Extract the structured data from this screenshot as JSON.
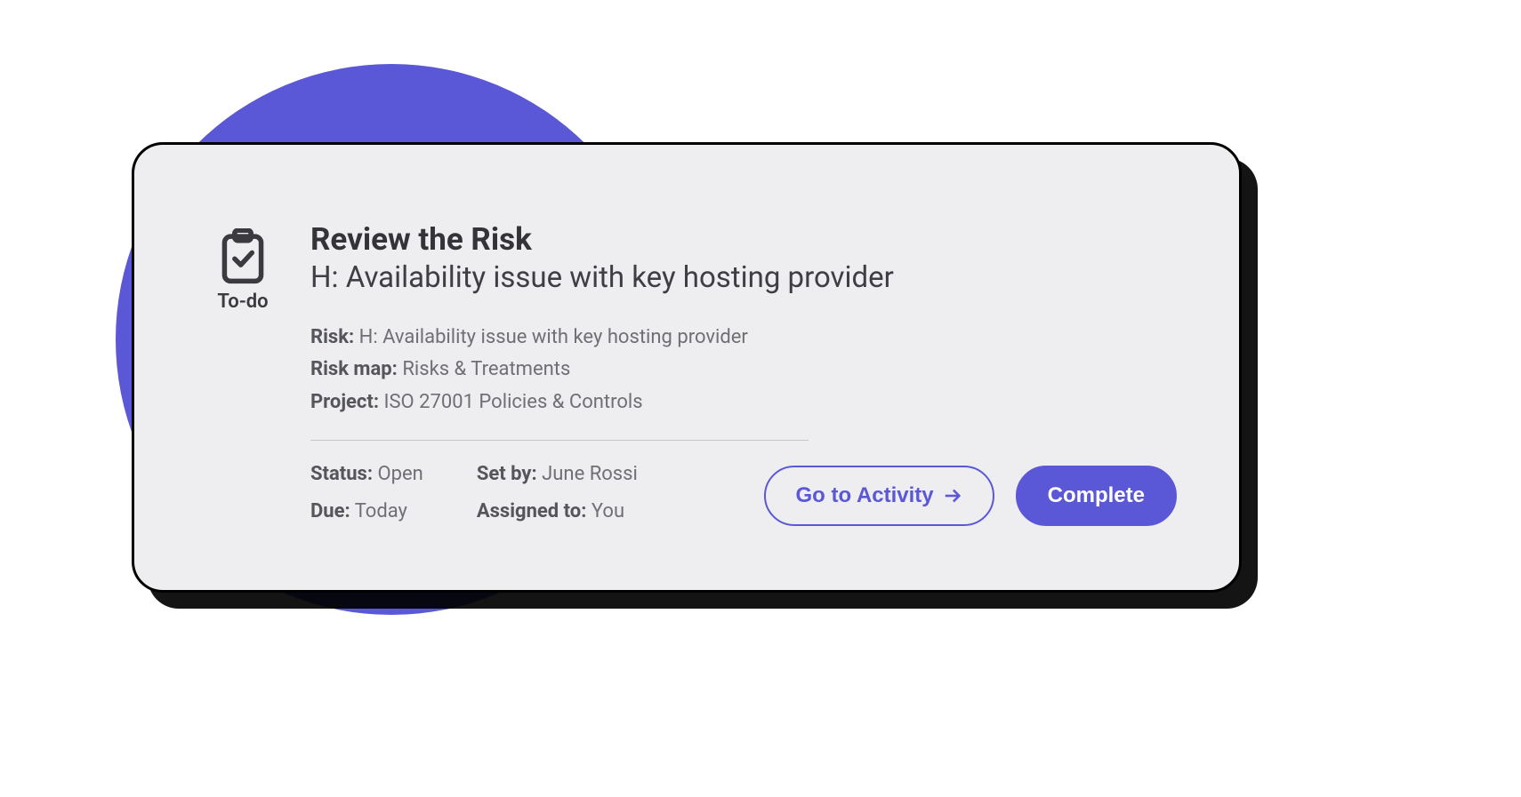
{
  "colors": {
    "accent": "#5a58d6"
  },
  "todo": {
    "label": "To-do",
    "icon": "clipboard-check-icon"
  },
  "card": {
    "title": "Review the Risk",
    "subtitle": "H: Availability issue with key hosting provider"
  },
  "meta": {
    "risk_label": "Risk:",
    "risk_value": "H: Availability issue with key hosting provider",
    "risk_map_label": "Risk map:",
    "risk_map_value": "Risks & Treatments",
    "project_label": "Project:",
    "project_value": "ISO 27001 Policies & Controls"
  },
  "status": {
    "status_label": "Status:",
    "status_value": "Open",
    "due_label": "Due:",
    "due_value": "Today",
    "set_by_label": "Set by:",
    "set_by_value": "June Rossi",
    "assigned_label": "Assigned to:",
    "assigned_value": "You"
  },
  "actions": {
    "go_to_activity": "Go to Activity",
    "complete": "Complete"
  }
}
